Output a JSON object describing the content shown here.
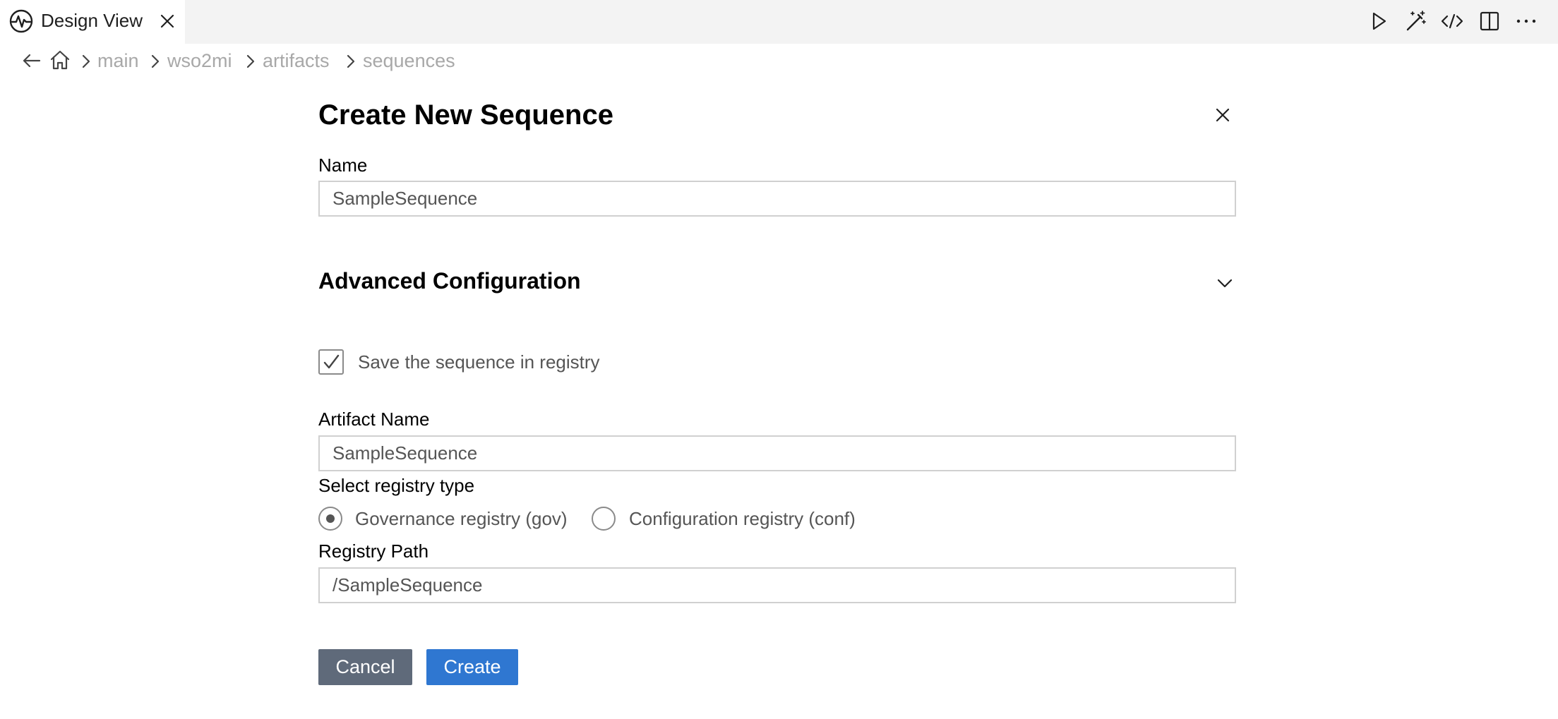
{
  "tab": {
    "label": "Design View",
    "icon": "activity-icon"
  },
  "toolbar": {
    "icons": [
      "run-icon",
      "magic-wand-icon",
      "code-icon",
      "split-editor-icon",
      "more-icon"
    ]
  },
  "breadcrumb": {
    "items": [
      "main",
      "wso2mi",
      "artifacts",
      "sequences"
    ]
  },
  "form": {
    "title": "Create New Sequence",
    "name_label": "Name",
    "name_value": "SampleSequence",
    "advanced_title": "Advanced Configuration",
    "save_in_registry_label": "Save the sequence in registry",
    "save_in_registry_checked": true,
    "artifact_name_label": "Artifact Name",
    "artifact_name_value": "SampleSequence",
    "registry_type_label": "Select registry type",
    "registry_options": [
      "Governance registry (gov)",
      "Configuration registry (conf)"
    ],
    "registry_selected": "Governance registry (gov)",
    "registry_path_label": "Registry Path",
    "registry_path_value": "/SampleSequence"
  },
  "buttons": {
    "cancel": "Cancel",
    "create": "Create"
  },
  "colors": {
    "primary": "#2f77d1",
    "secondary": "#5f6a7a",
    "muted_text": "#a8a8a8",
    "tabbar_bg": "#f3f3f3"
  }
}
